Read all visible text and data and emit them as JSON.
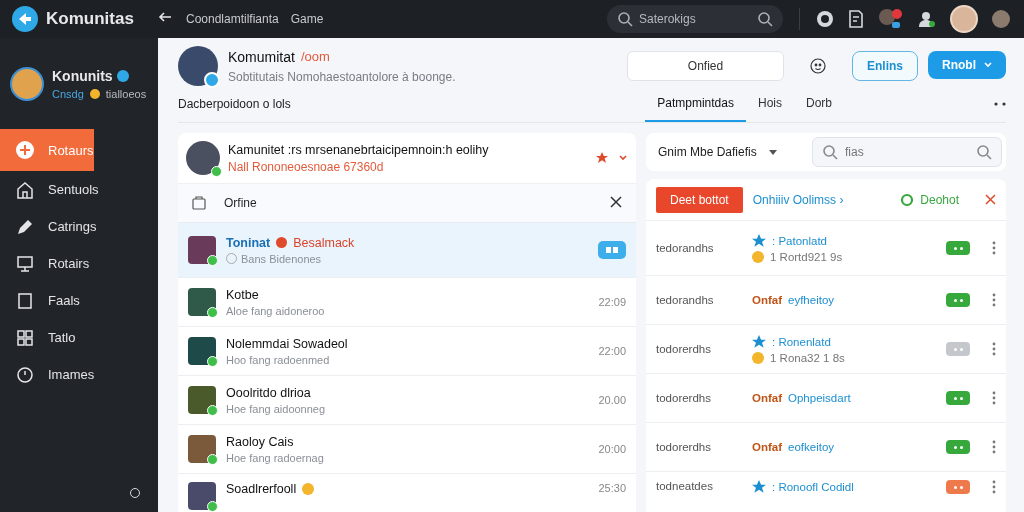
{
  "topbar": {
    "app_name": "Komunitas",
    "breadcrumb": "Coondlamtilfianta",
    "section": "Game",
    "search": {
      "placeholder": "Saterokigs"
    }
  },
  "profile": {
    "name": "Konunits",
    "status": "Cnsdg",
    "note": "tialloeos"
  },
  "sidebar": {
    "items": [
      {
        "label": "Rotaurs",
        "selected": true
      },
      {
        "label": "Sentuols",
        "selected": false
      },
      {
        "label": "Catrings",
        "selected": false
      },
      {
        "label": "Rotairs",
        "selected": false
      },
      {
        "label": "Faals",
        "selected": false
      },
      {
        "label": "Tatlo",
        "selected": false
      },
      {
        "label": "Imames",
        "selected": false
      }
    ]
  },
  "header": {
    "title": "Komumitat",
    "tag": "/oom",
    "subtitle": "Sobtitutais Nomohaestoantolore à boonge.",
    "field": {
      "value": "Onfied"
    },
    "buttons": [
      {
        "label": "Enlins",
        "kind": "outline"
      },
      {
        "label": "Rnobl",
        "kind": "primary"
      }
    ]
  },
  "tabs": {
    "caption": "Dacberpoidoon o lols",
    "items": [
      {
        "label": "Patmpmintdas",
        "selected": true
      },
      {
        "label": "Hois",
        "selected": false
      },
      {
        "label": "Dorb",
        "selected": false
      }
    ]
  },
  "conversation": {
    "title": "Kamunitet :rs mrsenanebrtaicipemnoin:h eolihy",
    "subtitle": "Nall Rononeoesnoae 67360d",
    "filter": "Orfine"
  },
  "list": [
    {
      "name": "Toninat",
      "tag": "Besalmack",
      "preview": "Bans Bidenones",
      "selected": true,
      "online": true
    },
    {
      "name": "Kotbe",
      "preview": "Aloe fang aidoneroo",
      "time": "22:09",
      "selected": false,
      "online": true
    },
    {
      "name": "Nolemmdai Sowadeol",
      "preview": "Hoo fang radoenmed",
      "time": "22:00",
      "selected": false,
      "online": true
    },
    {
      "name": "Ooolritdo dlrioa",
      "preview": "Hoe fang aidoonneg",
      "time": "20.00",
      "selected": false,
      "online": true
    },
    {
      "name": "Raoloy Cais",
      "preview": "Hoe fang radoernag",
      "time": "20:00",
      "selected": false,
      "online": true
    },
    {
      "name": "Soadlrerfooll",
      "time": "25:30",
      "selected": false,
      "online": true
    }
  ],
  "filters": {
    "dropdown": "Gnim Mbe Dafiefis",
    "search": {
      "placeholder": "fias"
    }
  },
  "detail": {
    "action": "Deet bottot",
    "link": "Onhiiiv Oolimss ›",
    "status": "Deohot",
    "rows": [
      {
        "label": "tedorandhs",
        "kind": "rating",
        "line1": ": Patonlatd",
        "line2": "1 Rortd921 9s",
        "color": "#36a83c"
      },
      {
        "label": "tedorandhs",
        "kind": "status",
        "state": "Onfaf",
        "info": "eyfheitoy",
        "color": "#36a83c"
      },
      {
        "label": "todorerdhs",
        "kind": "rating",
        "line1": ": Ronenlatd",
        "line2": "1 Rona32 1 8s",
        "color": "#c4c7cc"
      },
      {
        "label": "todorerdhs",
        "kind": "status",
        "state": "Onfaf",
        "info": "Ophpeisdart",
        "color": "#36a83c"
      },
      {
        "label": "todorerdhs",
        "kind": "status",
        "state": "Onfaf",
        "info": "eofkeitoy",
        "color": "#36a83c"
      },
      {
        "label": "todneatdes",
        "kind": "rating",
        "line1": ": Ronoofl Codidl",
        "color": "#ee7a4c"
      }
    ]
  }
}
